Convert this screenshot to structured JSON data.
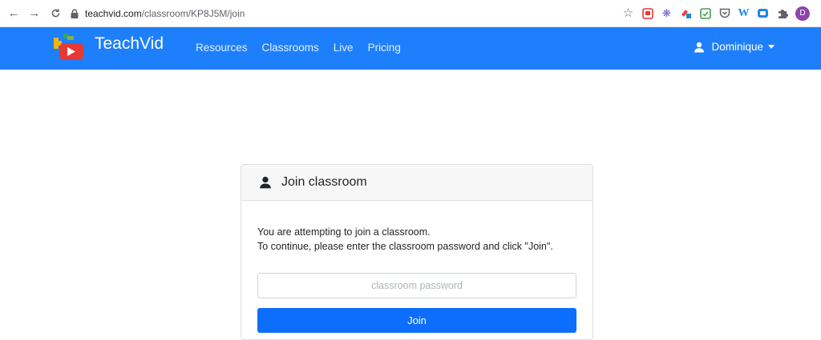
{
  "browser": {
    "url_host": "teachvid.com",
    "url_path": "/classroom/KP8J5M/join",
    "profile_initial": "D",
    "icons": [
      "back-icon",
      "forward-icon",
      "reload-icon",
      "lock-icon",
      "star-icon",
      "extensions-icon"
    ]
  },
  "navbar": {
    "brand": "TeachVid",
    "links": [
      "Resources",
      "Classrooms",
      "Live",
      "Pricing"
    ],
    "user": "Dominique",
    "color": "#1e7ffc"
  },
  "card": {
    "title": "Join classroom",
    "line1": "You are attempting to join a classroom.",
    "line2": "To continue, please enter the classroom password and click \"Join\".",
    "password_placeholder": "classroom password",
    "password_value": "",
    "button": "Join",
    "button_color": "#0d6efd"
  }
}
